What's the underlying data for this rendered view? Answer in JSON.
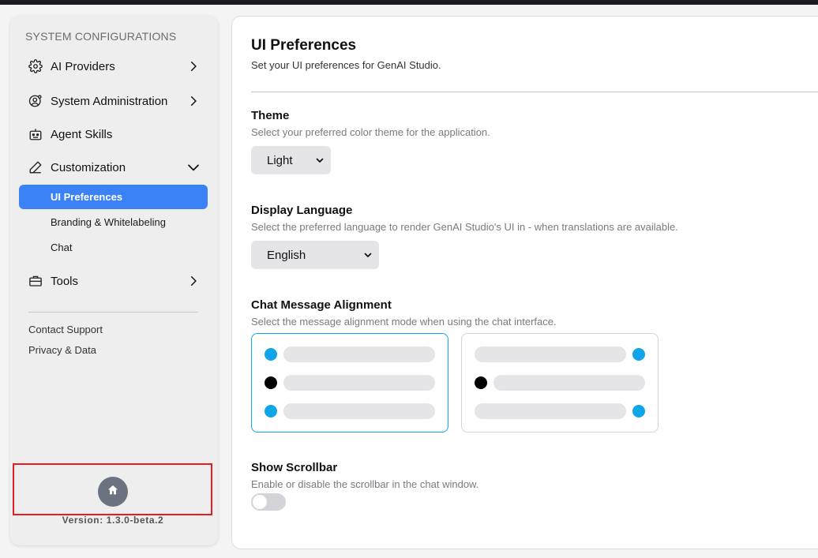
{
  "sidebar": {
    "heading": "SYSTEM CONFIGURATIONS",
    "items": [
      {
        "label": "AI Providers",
        "icon": "gear-icon",
        "chevron": "right"
      },
      {
        "label": "System Administration",
        "icon": "user-cog-icon",
        "chevron": "right"
      },
      {
        "label": "Agent Skills",
        "icon": "robot-icon",
        "chevron": null
      },
      {
        "label": "Customization",
        "icon": "pencil-icon",
        "chevron": "down"
      },
      {
        "label": "Tools",
        "icon": "briefcase-icon",
        "chevron": "right"
      }
    ],
    "sub_items": [
      {
        "label": "UI Preferences",
        "active": true
      },
      {
        "label": "Branding & Whitelabeling",
        "active": false
      },
      {
        "label": "Chat",
        "active": false
      }
    ],
    "footer_links": [
      "Contact Support",
      "Privacy & Data"
    ],
    "home_icon": "home-icon",
    "version": "Version: 1.3.0-beta.2"
  },
  "main": {
    "title": "UI Preferences",
    "subtitle": "Set your UI preferences for GenAI Studio.",
    "theme": {
      "title": "Theme",
      "desc": "Select your preferred color theme for the application.",
      "value": "Light"
    },
    "language": {
      "title": "Display Language",
      "desc": "Select the preferred language to render GenAI Studio's UI in - when translations are available.",
      "value": "English"
    },
    "alignment": {
      "title": "Chat Message Alignment",
      "desc": "Select the message alignment mode when using the chat interface.",
      "selected": "left"
    },
    "scrollbar": {
      "title": "Show Scrollbar",
      "desc": "Enable or disable the scrollbar in the chat window.",
      "enabled": false
    }
  },
  "colors": {
    "accent": "#3b82f6",
    "preview_blue": "#0ea5e9",
    "highlight_box": "#e31e24"
  }
}
